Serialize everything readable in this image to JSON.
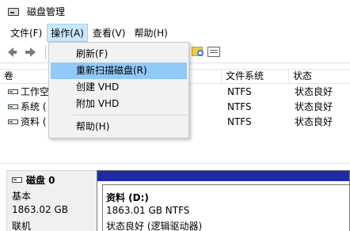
{
  "window": {
    "title": "磁盘管理"
  },
  "menubar": {
    "items": [
      "文件(F)",
      "操作(A)",
      "查看(V)",
      "帮助(H)"
    ]
  },
  "action_menu": {
    "items": [
      "刷新(F)",
      "重新扫描磁盘(R)",
      "创建 VHD",
      "附加 VHD",
      "帮助(H)"
    ],
    "highlighted": "重新扫描磁盘(R)"
  },
  "volume_list": {
    "columns": [
      "卷",
      "文件系统",
      "状态"
    ],
    "rows": [
      {
        "name": "工作空",
        "fs": "NTFS",
        "status": "状态良好"
      },
      {
        "name": "系统 (",
        "fs": "NTFS",
        "status": "状态良好"
      },
      {
        "name": "资料 (",
        "fs": "NTFS",
        "status": "状态良好"
      }
    ]
  },
  "disk": {
    "name": "磁盘 0",
    "type": "基本",
    "size": "1863.02 GB",
    "state": "联机"
  },
  "partition": {
    "name": "资料  (D:)",
    "size_fs": "1863.01 GB NTFS",
    "status": "状态良好 (逻辑驱动器)",
    "bar_color": "#1f2aa6"
  }
}
